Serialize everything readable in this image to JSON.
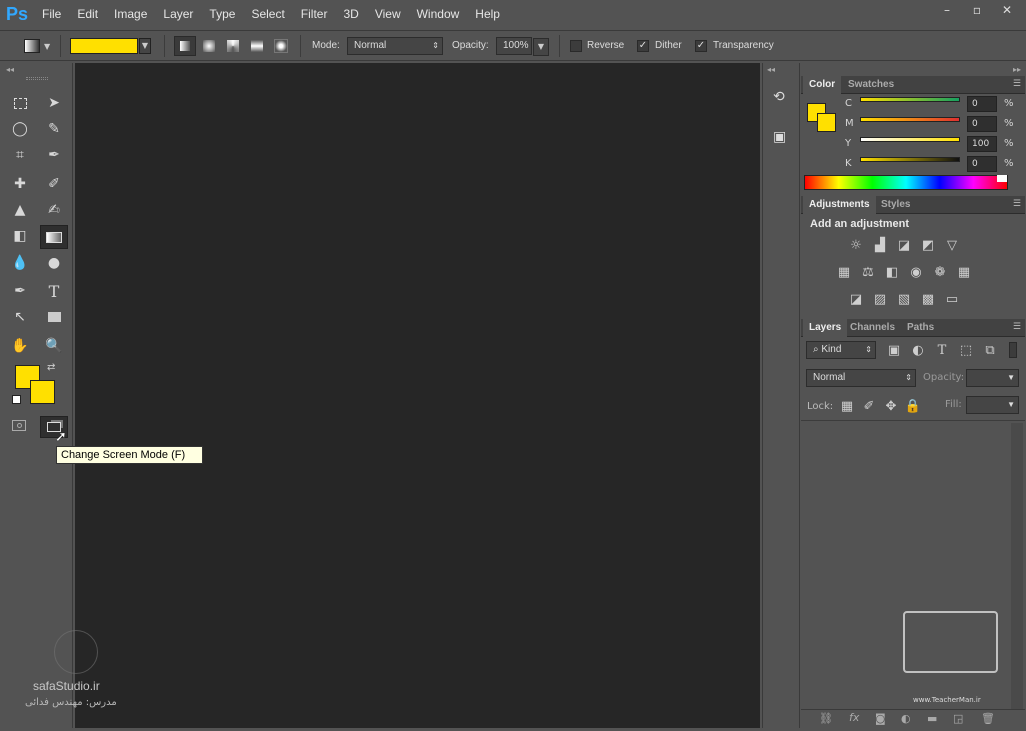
{
  "app": {
    "logo": "Ps"
  },
  "menu": [
    "File",
    "Edit",
    "Image",
    "Layer",
    "Type",
    "Select",
    "Filter",
    "3D",
    "View",
    "Window",
    "Help"
  ],
  "window_controls": [
    "–",
    "▫",
    "✕"
  ],
  "options": {
    "mode_label": "Mode:",
    "mode_value": "Normal",
    "opacity_label": "Opacity:",
    "opacity_value": "100%",
    "reverse_label": "Reverse",
    "dither_label": "Dither",
    "transparency_label": "Transparency",
    "gradient_color": "#ffe000"
  },
  "colors": {
    "foreground": "#ffe000",
    "background": "#ffe000"
  },
  "tooltip": "Change Screen Mode (F)",
  "color_panel": {
    "tabs": [
      "Color",
      "Swatches"
    ],
    "channels": [
      {
        "label": "C",
        "value": "0",
        "pct": "%"
      },
      {
        "label": "M",
        "value": "0",
        "pct": "%"
      },
      {
        "label": "Y",
        "value": "100",
        "pct": "%"
      },
      {
        "label": "K",
        "value": "0",
        "pct": "%"
      }
    ]
  },
  "adjustments_panel": {
    "tabs": [
      "Adjustments",
      "Styles"
    ],
    "heading": "Add an adjustment"
  },
  "layers_panel": {
    "tabs": [
      "Layers",
      "Channels",
      "Paths"
    ],
    "kind_label": "Kind",
    "blend_value": "Normal",
    "opacity_label": "Opacity:",
    "lock_label": "Lock:",
    "fill_label": "Fill:"
  },
  "watermark": {
    "left_site": "safaStudio.ir",
    "left_caption": "مدرس: مهندس فدائی",
    "right_site": "www.TeacherMan.ir"
  }
}
